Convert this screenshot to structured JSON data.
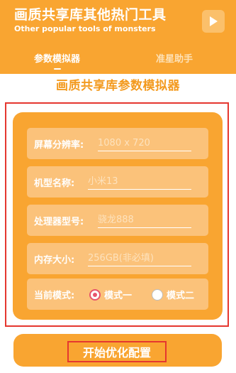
{
  "header": {
    "title": "画质共享库其他热门工具",
    "subtitle": "Other popular tools of monsters",
    "tabs": [
      {
        "label": "参数模拟器",
        "active": true
      },
      {
        "label": "准星助手",
        "active": false
      }
    ]
  },
  "section_title": "画质共享库参数模拟器",
  "form": {
    "resolution": {
      "label": "屏幕分辨率:",
      "placeholder": "1080 x 720"
    },
    "model": {
      "label": "机型名称:",
      "placeholder": "小米13"
    },
    "processor": {
      "label": "处理器型号:",
      "placeholder": "骁龙888"
    },
    "memory": {
      "label": "内存大小:",
      "placeholder": "256GB(非必填)"
    },
    "mode": {
      "label": "当前模式:",
      "options": [
        "模式一",
        "模式二"
      ],
      "selected": "模式一"
    }
  },
  "start_button": {
    "label": "开始优化配置"
  },
  "colors": {
    "brand_orange": "#f9a531",
    "row_fill": "#fbc27a",
    "heading_orange": "#f39a1f",
    "annotation_red": "#e5372f",
    "radio_pink": "#e8546e"
  },
  "icons": {
    "play": "play-icon"
  }
}
